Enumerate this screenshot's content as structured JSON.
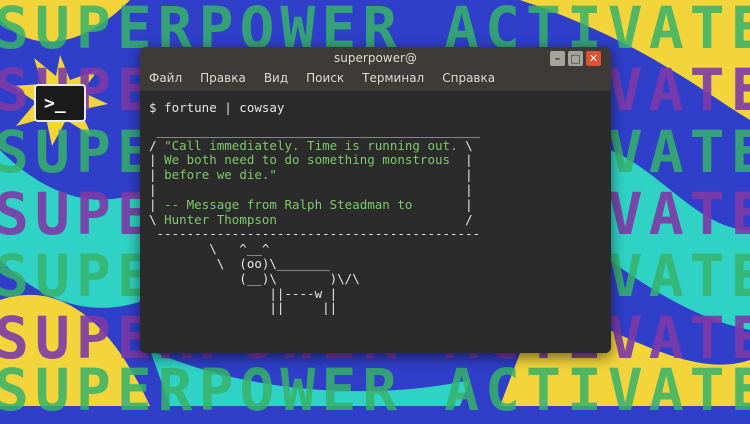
{
  "background": {
    "headline": "SUPERPOWER ACTIVATED",
    "colors": {
      "base": "#2f3fc9",
      "yellow": "#f3d43a",
      "cyan": "#2fd2c4",
      "green_text": "#36b36a",
      "purple_text": "#7e3aa8"
    }
  },
  "app_icon": {
    "glyph": ">_",
    "icon": "terminal-icon"
  },
  "window": {
    "title": "superpower@",
    "menu": [
      "Файл",
      "Правка",
      "Вид",
      "Поиск",
      "Терминал",
      "Справка"
    ],
    "controls": {
      "minimize": "–",
      "maximize": "□",
      "close": "✕"
    }
  },
  "terminal": {
    "command": "$ fortune | cowsay",
    "bubble_top": " ___________________________________________",
    "bubble_lines": [
      {
        "border": "/ ",
        "text": "\"Call immediately. Time is running out.",
        "end": " \\"
      },
      {
        "border": "| ",
        "text": "We both need to do something monstrous ",
        "end": " |"
      },
      {
        "border": "| ",
        "text": "before we die.\"                        ",
        "end": " |"
      },
      {
        "border": "| ",
        "text": "                                       ",
        "end": " |"
      },
      {
        "border": "| ",
        "text": "-- Message from Ralph Steadman to      ",
        "end": " |"
      },
      {
        "border": "\\ ",
        "text": "Hunter Thompson                        ",
        "end": " /"
      }
    ],
    "bubble_bottom": " -------------------------------------------",
    "cow_lines": [
      "        \\   ^__^",
      "         \\  (oo)\\_______",
      "            (__)\\       )\\/\\",
      "                ||----w |",
      "                ||     ||"
    ]
  }
}
